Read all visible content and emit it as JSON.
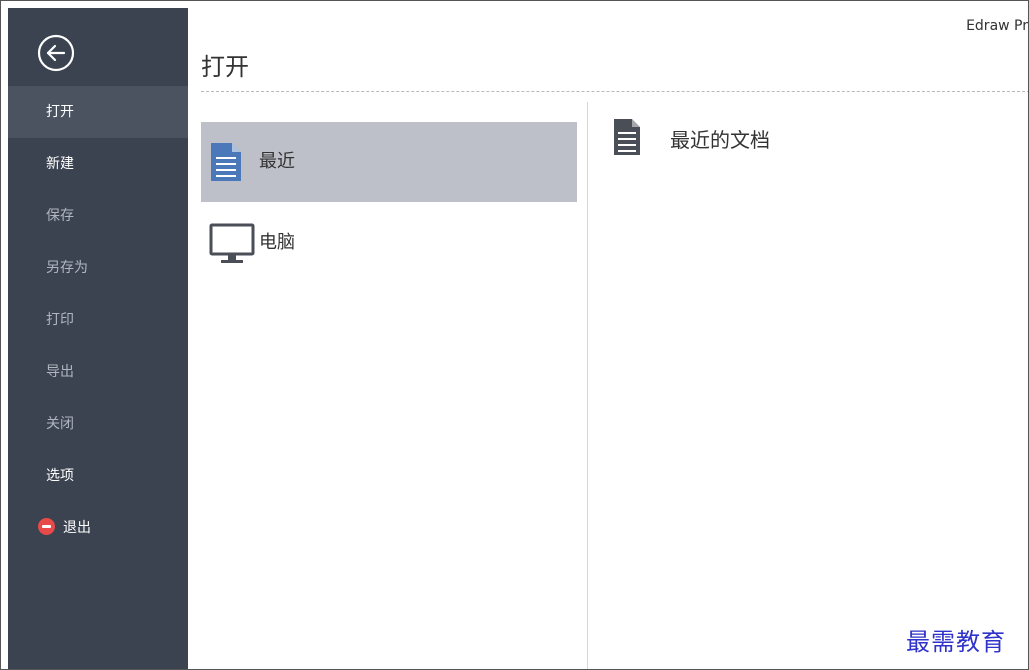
{
  "window": {
    "app_title": "Edraw Pr"
  },
  "sidebar": {
    "back_icon": "back-arrow-circle-icon",
    "items": [
      {
        "label": "打开",
        "state": "active"
      },
      {
        "label": "新建",
        "state": "normal"
      },
      {
        "label": "保存",
        "state": "dim"
      },
      {
        "label": "另存为",
        "state": "dim"
      },
      {
        "label": "打印",
        "state": "dim"
      },
      {
        "label": "导出",
        "state": "dim"
      },
      {
        "label": "关闭",
        "state": "dim"
      },
      {
        "label": "选项",
        "state": "normal"
      },
      {
        "label": "退出",
        "state": "normal",
        "icon": "exit-icon"
      }
    ]
  },
  "main": {
    "title": "打开",
    "locations": [
      {
        "label": "最近",
        "icon": "document-icon",
        "selected": true
      },
      {
        "label": "电脑",
        "icon": "monitor-icon",
        "selected": false
      }
    ],
    "recent": {
      "title": "最近的文档",
      "icon": "document-icon"
    }
  },
  "watermark": {
    "text": "最需教育"
  },
  "colors": {
    "sidebar_bg": "#3b4350",
    "sidebar_active": "#4b5361",
    "selected_bg": "#bdc0c9",
    "accent_blue": "#4a78b8",
    "exit_red": "#e84a4a",
    "watermark": "#2f33c9"
  }
}
